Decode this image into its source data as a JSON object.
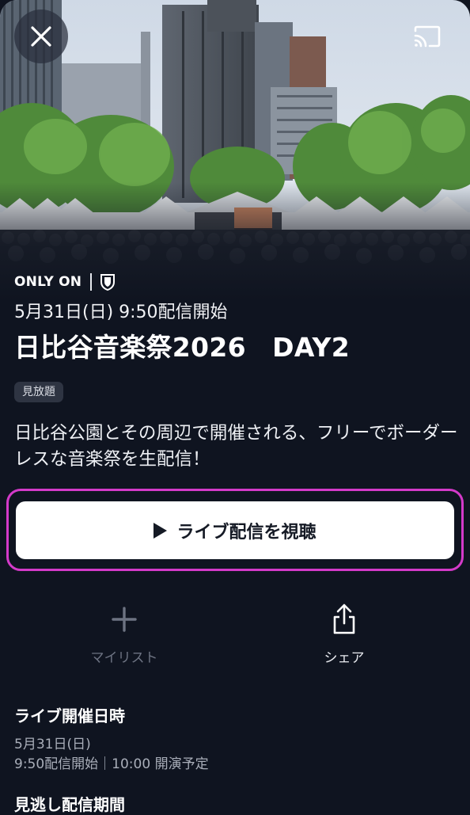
{
  "hero": {
    "close_icon": "close-icon",
    "cast_icon": "cast-icon"
  },
  "program": {
    "only_on": "ONLY ON",
    "shield_icon": "shield-icon",
    "date_line": "5月31日(日) 9:50配信開始",
    "title": "日比谷音楽祭2026　DAY2",
    "tag": "見放題",
    "description": "日比谷公園とその周辺で開催される、フリーでボーダーレスな音楽祭を生配信！"
  },
  "cta": {
    "label": "ライブ配信を視聴",
    "highlight_color": "#d43ac9"
  },
  "actions": {
    "mylist_label": "マイリスト",
    "share_label": "シェア"
  },
  "live_info": {
    "heading": "ライブ開催日時",
    "date": "5月31日(日)",
    "schedule": "9:50配信開始｜10:00 開演予定"
  },
  "next_section": {
    "heading": "見逃し配信期間"
  },
  "colors": {
    "background": "#0f1420",
    "accent": "#d43ac9",
    "button": "#ffffff"
  }
}
